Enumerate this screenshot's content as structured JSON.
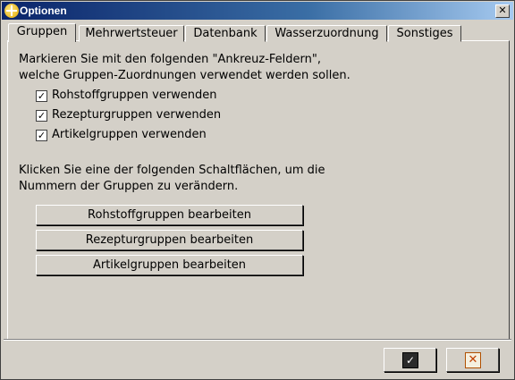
{
  "window": {
    "title": "Optionen",
    "close_symbol": "✕"
  },
  "tabs": [
    {
      "label": "Gruppen"
    },
    {
      "label": "Mehrwertsteuer"
    },
    {
      "label": "Datenbank"
    },
    {
      "label": "Wasserzuordnung"
    },
    {
      "label": "Sonstiges"
    }
  ],
  "content": {
    "intro_line1": "Markieren Sie mit den folgenden \"Ankreuz-Feldern\",",
    "intro_line2": "welche Gruppen-Zuordnungen verwendet werden sollen.",
    "checkboxes": [
      {
        "label": "Rohstoffgruppen verwenden",
        "checked": true,
        "mark": "✓"
      },
      {
        "label": "Rezepturgruppen verwenden",
        "checked": true,
        "mark": "✓"
      },
      {
        "label": "Artikelgruppen verwenden",
        "checked": true,
        "mark": "✓"
      }
    ],
    "hint_line1": "Klicken Sie eine der folgenden Schaltflächen, um die",
    "hint_line2": "Nummern der Gruppen zu verändern.",
    "buttons": [
      {
        "label": "Rohstoffgruppen bearbeiten"
      },
      {
        "label": "Rezepturgruppen bearbeiten"
      },
      {
        "label": "Artikelgruppen bearbeiten"
      }
    ]
  },
  "dialog_buttons": {
    "ok_icon": "check-icon",
    "ok_symbol": "✓",
    "cancel_icon": "cancel-x-icon",
    "cancel_symbol": "✕"
  },
  "colors": {
    "title_start": "#0a246a",
    "title_end": "#a6caf0",
    "face": "#d4d0c8"
  }
}
